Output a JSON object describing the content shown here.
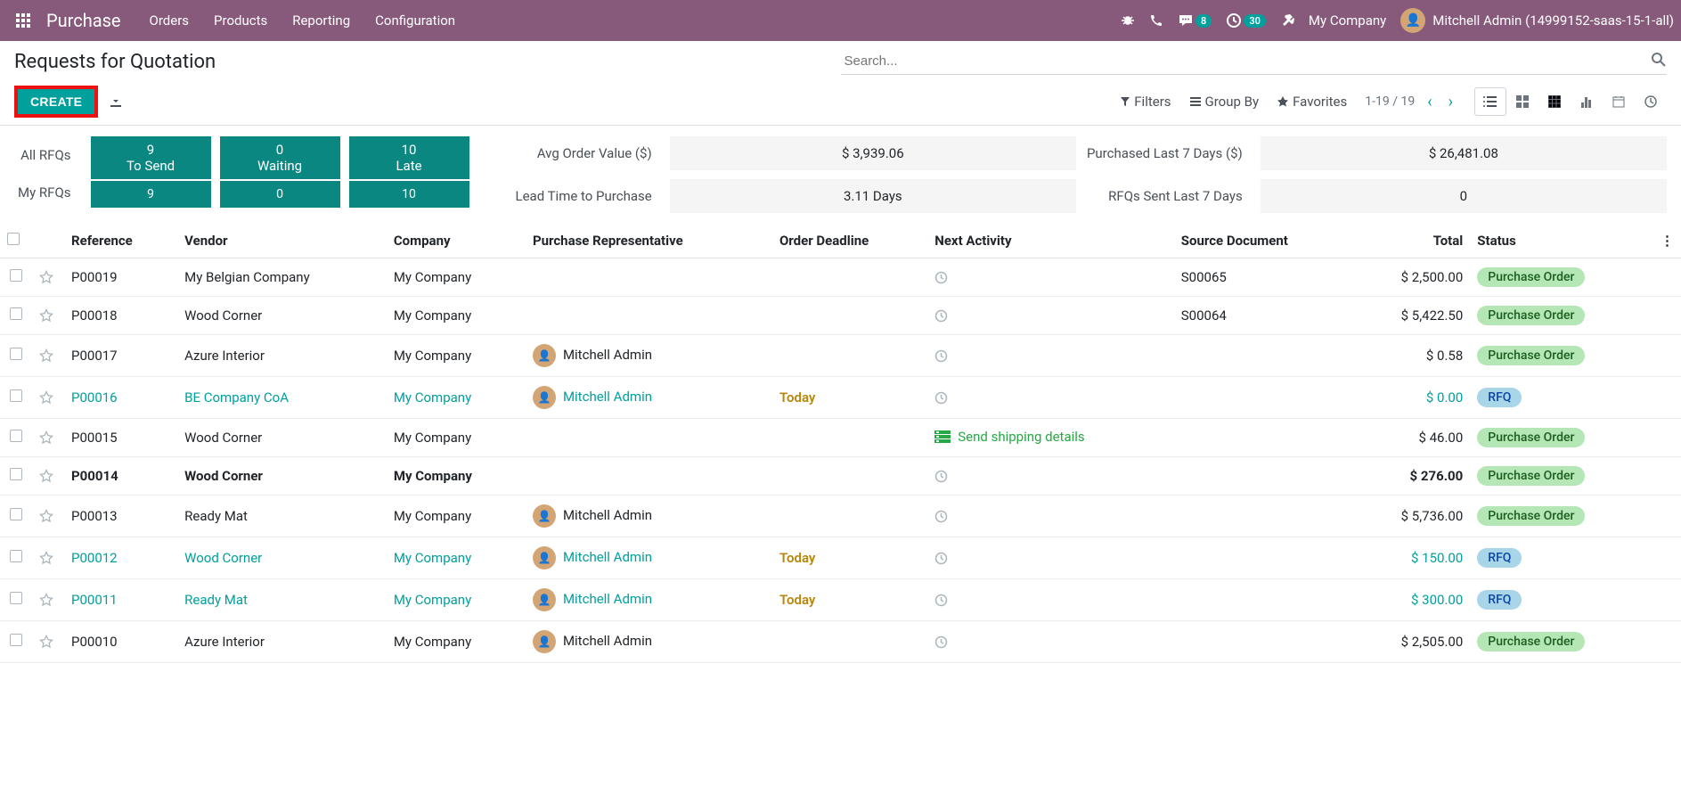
{
  "nav": {
    "app_name": "Purchase",
    "menus": [
      "Orders",
      "Products",
      "Reporting",
      "Configuration"
    ],
    "company": "My Company",
    "user": "Mitchell Admin (14999152-saas-15-1-all)",
    "msg_badge": "8",
    "activity_badge": "30"
  },
  "page": {
    "title": "Requests for Quotation",
    "search_placeholder": "Search...",
    "create_label": "CREATE",
    "filters_label": "Filters",
    "groupby_label": "Group By",
    "favorites_label": "Favorites",
    "pager": "1-19 / 19"
  },
  "dashboard": {
    "all_rfqs_label": "All RFQs",
    "my_rfqs_label": "My RFQs",
    "tosend_num": "9",
    "tosend_label": "To Send",
    "waiting_num": "0",
    "waiting_label": "Waiting",
    "late_num": "10",
    "late_label": "Late",
    "my_tosend": "9",
    "my_waiting": "0",
    "my_late": "10",
    "avg_order_label": "Avg Order Value ($)",
    "avg_order_val": "$ 3,939.06",
    "lead_time_label": "Lead Time to Purchase",
    "lead_time_val": "3.11  Days",
    "purchased_label": "Purchased Last 7 Days ($)",
    "purchased_val": "$ 26,481.08",
    "rfqs_sent_label": "RFQs Sent Last 7 Days",
    "rfqs_sent_val": "0"
  },
  "table": {
    "headers": {
      "ref": "Reference",
      "vendor": "Vendor",
      "company": "Company",
      "rep": "Purchase Representative",
      "deadline": "Order Deadline",
      "activity": "Next Activity",
      "source": "Source Document",
      "total": "Total",
      "status": "Status"
    },
    "rows": [
      {
        "ref": "P00019",
        "vendor": "My Belgian Company",
        "company": "My Company",
        "rep": "",
        "avatar": false,
        "deadline": "",
        "activity": "clock",
        "source": "S00065",
        "total": "$ 2,500.00",
        "status": "Purchase Order",
        "status_cls": "po",
        "highlight": false,
        "link": false
      },
      {
        "ref": "P00018",
        "vendor": "Wood Corner",
        "company": "My Company",
        "rep": "",
        "avatar": false,
        "deadline": "",
        "activity": "clock",
        "source": "S00064",
        "total": "$ 5,422.50",
        "status": "Purchase Order",
        "status_cls": "po",
        "highlight": false,
        "link": false
      },
      {
        "ref": "P00017",
        "vendor": "Azure Interior",
        "company": "My Company",
        "rep": "Mitchell Admin",
        "avatar": true,
        "deadline": "",
        "activity": "clock",
        "source": "",
        "total": "$ 0.58",
        "status": "Purchase Order",
        "status_cls": "po",
        "highlight": false,
        "link": false
      },
      {
        "ref": "P00016",
        "vendor": "BE Company CoA",
        "company": "My Company",
        "rep": "Mitchell Admin",
        "avatar": true,
        "deadline": "Today",
        "activity": "clock",
        "source": "",
        "total": "$ 0.00",
        "status": "RFQ",
        "status_cls": "rfq",
        "highlight": false,
        "link": true
      },
      {
        "ref": "P00015",
        "vendor": "Wood Corner",
        "company": "My Company",
        "rep": "",
        "avatar": false,
        "deadline": "",
        "activity": "shipping",
        "activity_text": "Send shipping details",
        "source": "",
        "total": "$ 46.00",
        "status": "Purchase Order",
        "status_cls": "po",
        "highlight": false,
        "link": false
      },
      {
        "ref": "P00014",
        "vendor": "Wood Corner",
        "company": "My Company",
        "rep": "",
        "avatar": false,
        "deadline": "",
        "activity": "clock",
        "source": "",
        "total": "$ 276.00",
        "status": "Purchase Order",
        "status_cls": "po",
        "highlight": true,
        "link": false
      },
      {
        "ref": "P00013",
        "vendor": "Ready Mat",
        "company": "My Company",
        "rep": "Mitchell Admin",
        "avatar": true,
        "deadline": "",
        "activity": "clock",
        "source": "",
        "total": "$ 5,736.00",
        "status": "Purchase Order",
        "status_cls": "po",
        "highlight": false,
        "link": false
      },
      {
        "ref": "P00012",
        "vendor": "Wood Corner",
        "company": "My Company",
        "rep": "Mitchell Admin",
        "avatar": true,
        "deadline": "Today",
        "activity": "clock",
        "source": "",
        "total": "$ 150.00",
        "status": "RFQ",
        "status_cls": "rfq",
        "highlight": false,
        "link": true
      },
      {
        "ref": "P00011",
        "vendor": "Ready Mat",
        "company": "My Company",
        "rep": "Mitchell Admin",
        "avatar": true,
        "deadline": "Today",
        "activity": "clock",
        "source": "",
        "total": "$ 300.00",
        "status": "RFQ",
        "status_cls": "rfq",
        "highlight": false,
        "link": true
      },
      {
        "ref": "P00010",
        "vendor": "Azure Interior",
        "company": "My Company",
        "rep": "Mitchell Admin",
        "avatar": true,
        "deadline": "",
        "activity": "clock",
        "source": "",
        "total": "$ 2,505.00",
        "status": "Purchase Order",
        "status_cls": "po",
        "highlight": false,
        "link": false
      }
    ]
  }
}
